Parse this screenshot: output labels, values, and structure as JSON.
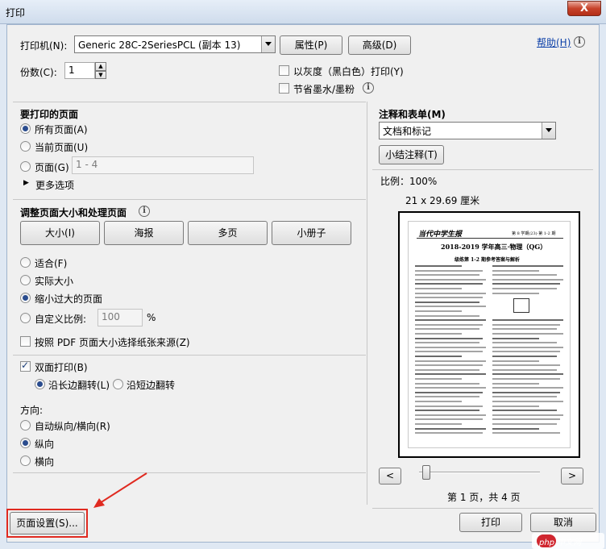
{
  "window": {
    "title": "打印",
    "close_glyph": "X"
  },
  "printer": {
    "label": "打印机(N):",
    "value": "Generic 28C-2SeriesPCL (副本 13)",
    "properties_button": "属性(P)",
    "advanced_button": "高级(D)",
    "help_link": "帮助(H)"
  },
  "copies": {
    "label": "份数(C):",
    "value": "1"
  },
  "options": {
    "grayscale": "以灰度（黑白色）打印(Y)",
    "save_ink": "节省墨水/墨粉"
  },
  "pages": {
    "heading": "要打印的页面",
    "all": "所有页面(A)",
    "current": "当前页面(U)",
    "range_label": "页面(G)",
    "range_value": "1 - 4",
    "more": "更多选项"
  },
  "sizing": {
    "heading": "调整页面大小和处理页面",
    "size_button": "大小(I)",
    "poster_button": "海报",
    "multiple_button": "多页",
    "booklet_button": "小册子",
    "fit": "适合(F)",
    "actual": "实际大小",
    "shrink": "缩小过大的页面",
    "custom": "自定义比例:",
    "custom_value": "100",
    "percent": "%",
    "pdf_source": "按照 PDF 页面大小选择纸张来源(Z)"
  },
  "duplex": {
    "label": "双面打印(B)",
    "long_edge": "沿长边翻转(L)",
    "short_edge": "沿短边翻转"
  },
  "orientation": {
    "heading": "方向:",
    "auto": "自动纵向/横向(R)",
    "portrait": "纵向",
    "landscape": "横向"
  },
  "comments": {
    "heading": "注释和表单(M)",
    "value": "文档和标记",
    "summarize_button": "小结注释(T)"
  },
  "preview": {
    "scale": "比例：100%",
    "size": "21 x 29.69 厘米",
    "prev": "<",
    "next": ">",
    "page_info": "第 1 页，共 4 页",
    "doc": {
      "logo": "当代中学生报",
      "header_right": "第 8 学期(23)·第 1-2 期",
      "title": "2018-2019 学年高三·物理（QG）",
      "subtitle": "级练第 1-2 期参考答案与解析"
    }
  },
  "footer": {
    "page_setup_button": "页面设置(S)...",
    "print_button": "打印",
    "cancel_button": "取消"
  },
  "watermark": {
    "text": "php 中文网"
  },
  "colors": {
    "annotation_red": "#e02a20",
    "help_link": "#0b3fa8",
    "php_badge": "#d0262f"
  }
}
